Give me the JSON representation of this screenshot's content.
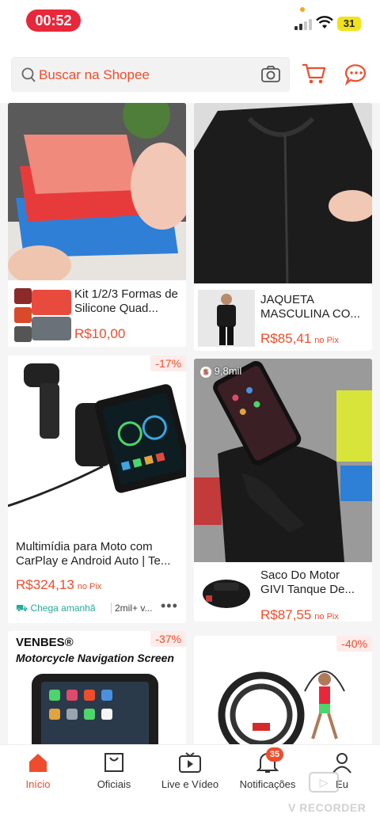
{
  "status": {
    "time": "00:52",
    "battery": "31"
  },
  "search": {
    "placeholder": "Buscar na Shopee"
  },
  "products": [
    {
      "title": "Kit 1/2/3 Formas de Silicone Quad...",
      "price": "R$10,00"
    },
    {
      "title": "JAQUETA MASCULINA CO...",
      "price": "R$85,41",
      "price_suffix": "no Pix"
    },
    {
      "discount": "-17%",
      "title": "Multimídia para Moto com CarPlay e Android Auto | Te...",
      "price": "R$324,13",
      "price_suffix": "no Pix",
      "delivery": "Chega amanhã",
      "sold": "2mil+ v..."
    },
    {
      "views": "9,8mil",
      "title": "Saco Do Motor GIVI Tanque De...",
      "price": "R$87,55",
      "price_suffix": "no Pix"
    },
    {
      "brand": "VENBES®",
      "banner_text": "Motorcycle Navigation Screen",
      "discount": "-37%"
    },
    {
      "discount": "-40%"
    }
  ],
  "nav": {
    "items": [
      {
        "label": "Início"
      },
      {
        "label": "Oficiais"
      },
      {
        "label": "Live e Vídeo"
      },
      {
        "label": "Notificações",
        "badge": "35"
      },
      {
        "label": "Eu"
      }
    ]
  },
  "watermark": "V RECORDER",
  "colors": {
    "accent": "#ee4d2d",
    "time_pill": "#e8283a"
  }
}
